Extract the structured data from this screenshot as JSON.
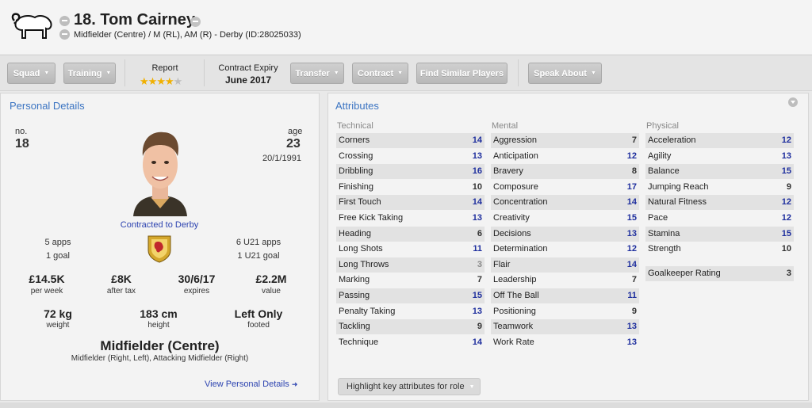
{
  "header": {
    "name": "18. Tom Cairney",
    "subtitle": "Midfielder (Centre) / M (RL), AM (R) - Derby (ID:28025033)"
  },
  "toolbar": {
    "squad": "Squad",
    "training": "Training",
    "report_label": "Report",
    "report_stars": 4,
    "contract_label": "Contract Expiry",
    "contract_value": "June 2017",
    "transfer": "Transfer",
    "contract": "Contract",
    "find_similar": "Find Similar Players",
    "speak_about": "Speak About"
  },
  "personal": {
    "title": "Personal Details",
    "no_label": "no.",
    "no_value": "18",
    "age_label": "age",
    "age_value": "23",
    "dob": "20/1/1991",
    "contract_line": "Contracted to Derby",
    "apps_left": "5 apps",
    "goals_left": "1 goal",
    "apps_right": "6 U21 apps",
    "goals_right": "1 U21 goal",
    "wage": "£14.5K",
    "wage_label": "per week",
    "after_tax": "£8K",
    "after_tax_label": "after tax",
    "expires": "30/6/17",
    "expires_label": "expires",
    "value": "£2.2M",
    "value_label": "value",
    "weight": "72 kg",
    "weight_label": "weight",
    "height": "183 cm",
    "height_label": "height",
    "footed": "Left Only",
    "footed_label": "footed",
    "position": "Midfielder (Centre)",
    "positions_other": "Midfielder (Right, Left), Attacking Midfielder (Right)",
    "view_link": "View Personal Details",
    "view_link_arrow": "➜"
  },
  "attributes": {
    "title": "Attributes",
    "technical_label": "Technical",
    "mental_label": "Mental",
    "physical_label": "Physical",
    "technical": [
      {
        "name": "Corners",
        "value": "14"
      },
      {
        "name": "Crossing",
        "value": "13"
      },
      {
        "name": "Dribbling",
        "value": "16"
      },
      {
        "name": "Finishing",
        "value": "10"
      },
      {
        "name": "First Touch",
        "value": "14"
      },
      {
        "name": "Free Kick Taking",
        "value": "13"
      },
      {
        "name": "Heading",
        "value": "6"
      },
      {
        "name": "Long Shots",
        "value": "11"
      },
      {
        "name": "Long Throws",
        "value": "3"
      },
      {
        "name": "Marking",
        "value": "7"
      },
      {
        "name": "Passing",
        "value": "15"
      },
      {
        "name": "Penalty Taking",
        "value": "13"
      },
      {
        "name": "Tackling",
        "value": "9"
      },
      {
        "name": "Technique",
        "value": "14"
      }
    ],
    "mental": [
      {
        "name": "Aggression",
        "value": "7"
      },
      {
        "name": "Anticipation",
        "value": "12"
      },
      {
        "name": "Bravery",
        "value": "8"
      },
      {
        "name": "Composure",
        "value": "17"
      },
      {
        "name": "Concentration",
        "value": "14"
      },
      {
        "name": "Creativity",
        "value": "15"
      },
      {
        "name": "Decisions",
        "value": "13"
      },
      {
        "name": "Determination",
        "value": "12"
      },
      {
        "name": "Flair",
        "value": "14"
      },
      {
        "name": "Leadership",
        "value": "7"
      },
      {
        "name": "Off The Ball",
        "value": "11"
      },
      {
        "name": "Positioning",
        "value": "9"
      },
      {
        "name": "Teamwork",
        "value": "13"
      },
      {
        "name": "Work Rate",
        "value": "13"
      }
    ],
    "physical": [
      {
        "name": "Acceleration",
        "value": "12"
      },
      {
        "name": "Agility",
        "value": "13"
      },
      {
        "name": "Balance",
        "value": "15"
      },
      {
        "name": "Jumping Reach",
        "value": "9"
      },
      {
        "name": "Natural Fitness",
        "value": "12"
      },
      {
        "name": "Pace",
        "value": "12"
      },
      {
        "name": "Stamina",
        "value": "15"
      },
      {
        "name": "Strength",
        "value": "10"
      }
    ],
    "goalkeeper": {
      "name": "Goalkeeper Rating",
      "value": "3"
    },
    "highlight_button": "Highlight key attributes for role"
  },
  "colors": {
    "accent_blue": "#3b74c2",
    "link_blue": "#2c43b0",
    "high_value": "#1f2f9e",
    "low_value": "#888888",
    "star": "#f0b000"
  }
}
